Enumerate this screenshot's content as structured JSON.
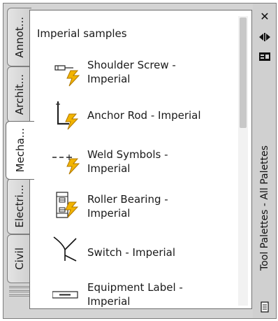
{
  "palette": {
    "title": "Tool Palettes - All Palettes",
    "close_icon": "close-icon",
    "autohide_icon": "autohide-icon",
    "properties_icon": "properties-icon"
  },
  "tabs": [
    {
      "label": "Annot...",
      "active": false
    },
    {
      "label": "Archit...",
      "active": false
    },
    {
      "label": "Mecha...",
      "active": true
    },
    {
      "label": "Electri...",
      "active": false
    },
    {
      "label": "Civil",
      "active": false
    }
  ],
  "panel": {
    "title": "Imperial samples",
    "tools": [
      {
        "line1": "Shoulder Screw -",
        "line2": "Imperial",
        "icon": "shoulder-screw-icon"
      },
      {
        "line1": "Anchor Rod - Imperial",
        "line2": "",
        "icon": "anchor-rod-icon"
      },
      {
        "line1": "Weld Symbols -",
        "line2": "Imperial",
        "icon": "weld-symbols-icon"
      },
      {
        "line1": "Roller Bearing -",
        "line2": "Imperial",
        "icon": "roller-bearing-icon"
      },
      {
        "line1": "Switch - Imperial",
        "line2": "",
        "icon": "switch-icon"
      },
      {
        "line1": "Equipment Label -",
        "line2": "Imperial",
        "icon": "equipment-label-icon"
      }
    ]
  },
  "colors": {
    "lightning": "#f2b400",
    "lightning_stroke": "#b07800"
  }
}
